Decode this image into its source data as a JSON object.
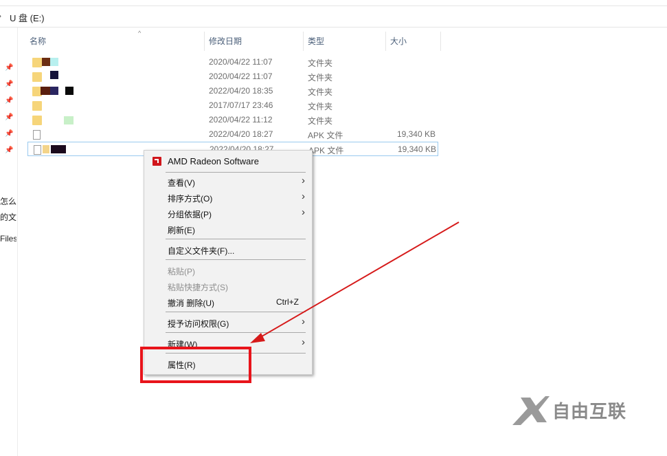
{
  "address": {
    "path": "U 盘 (E:)"
  },
  "nav": {
    "fragments": [
      "怎么修",
      "的文",
      "Files"
    ]
  },
  "columns": {
    "name": "名称",
    "date": "修改日期",
    "type": "类型",
    "size": "大小"
  },
  "rows": [
    {
      "icon": "folder",
      "date": "2020/04/22 11:07",
      "type": "文件夹",
      "size": ""
    },
    {
      "icon": "folder",
      "date": "2020/04/22 11:07",
      "type": "文件夹",
      "size": ""
    },
    {
      "icon": "folder",
      "date": "2022/04/20 18:35",
      "type": "文件夹",
      "size": ""
    },
    {
      "icon": "folder",
      "date": "2017/07/17 23:46",
      "type": "文件夹",
      "size": ""
    },
    {
      "icon": "folder",
      "date": "2020/04/22 11:12",
      "type": "文件夹",
      "size": ""
    },
    {
      "icon": "file",
      "date": "2022/04/20 18:27",
      "type": "APK 文件",
      "size": "19,340 KB"
    },
    {
      "icon": "file",
      "date": "2022/04/20 18:27",
      "type": "APK 文件",
      "size": "19,340 KB"
    }
  ],
  "context_menu": {
    "amd": "AMD Radeon Software",
    "view": "查看(V)",
    "sort": "排序方式(O)",
    "group": "分组依据(P)",
    "refresh": "刷新(E)",
    "customize": "自定义文件夹(F)...",
    "paste": "粘贴(P)",
    "paste_shortcut": "粘贴快捷方式(S)",
    "undo": "撤消 删除(U)",
    "undo_shortcut": "Ctrl+Z",
    "grant": "授予访问权限(G)",
    "new": "新建(W)",
    "properties": "属性(R)"
  },
  "annotation": {
    "box_color": "#e8141b",
    "arrow_color": "#d61a1a"
  },
  "watermark": {
    "text": "自由互联",
    "logo": "x-logo-icon"
  },
  "colors": {
    "folder": "#f6d57a",
    "selection_border": "#99c9ef",
    "menu_bg": "#f2f2f2",
    "amd_red": "#d0161b"
  }
}
